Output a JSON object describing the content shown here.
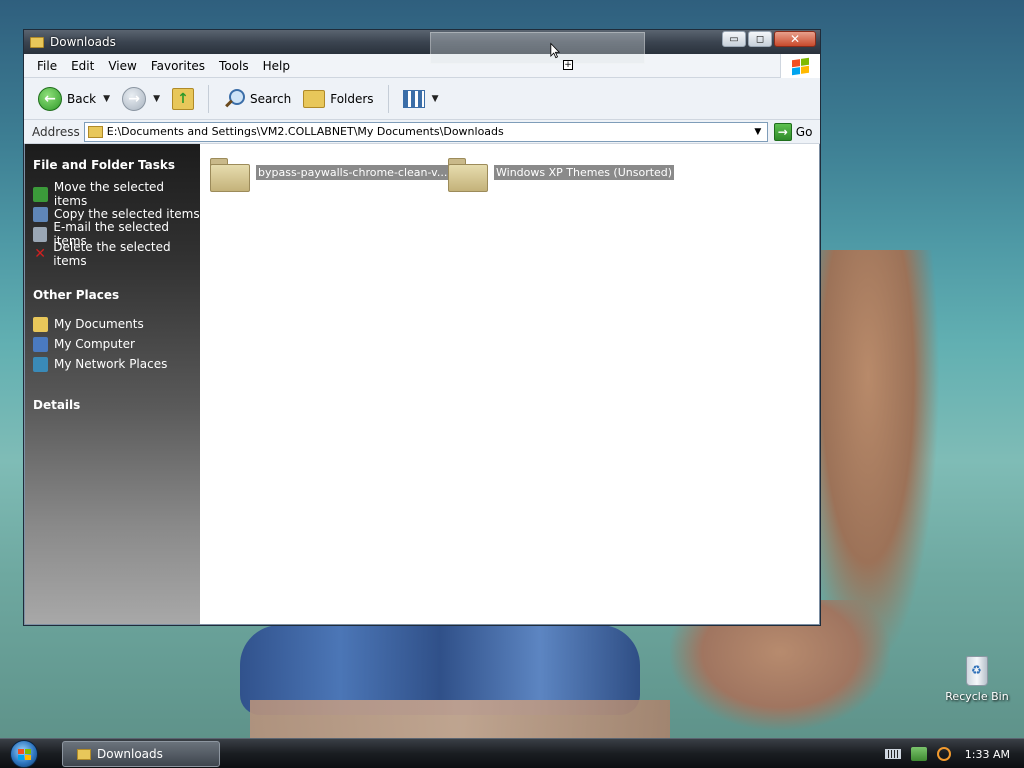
{
  "window": {
    "title": "Downloads",
    "buttons": {
      "minimize": "▭",
      "maximize": "◻",
      "close": "✕"
    }
  },
  "menu": [
    "File",
    "Edit",
    "View",
    "Favorites",
    "Tools",
    "Help"
  ],
  "toolbar": {
    "back_label": "Back",
    "search_label": "Search",
    "folders_label": "Folders"
  },
  "address": {
    "label": "Address",
    "value": "E:\\Documents and Settings\\VM2.COLLABNET\\My Documents\\Downloads",
    "go_label": "Go"
  },
  "tasks": {
    "file_folder_tasks": {
      "header": "File and Folder Tasks",
      "items": [
        {
          "label": "Move the selected items",
          "icon": "move-icon",
          "color": "#3b9a3a"
        },
        {
          "label": "Copy the selected items",
          "icon": "copy-icon",
          "color": "#5f86b8"
        },
        {
          "label": "E-mail the selected items",
          "icon": "email-icon",
          "color": "#9aa7b5"
        },
        {
          "label": "Delete the selected items",
          "icon": "delete-icon",
          "color": "#d02020"
        }
      ]
    },
    "other_places": {
      "header": "Other Places",
      "items": [
        {
          "label": "My Documents",
          "icon": "my-documents-icon",
          "color": "#e8c75a"
        },
        {
          "label": "My Computer",
          "icon": "my-computer-icon",
          "color": "#4a7ac0"
        },
        {
          "label": "My Network Places",
          "icon": "network-icon",
          "color": "#3a8ab8"
        }
      ]
    },
    "details": {
      "header": "Details"
    }
  },
  "files": [
    {
      "name": "bypass-paywalls-chrome-clean-v..."
    },
    {
      "name": "Windows XP Themes (Unsorted)"
    }
  ],
  "desktop": {
    "recycle_bin_label": "Recycle Bin"
  },
  "taskbar": {
    "task_label": "Downloads",
    "clock": "1:33 AM"
  }
}
